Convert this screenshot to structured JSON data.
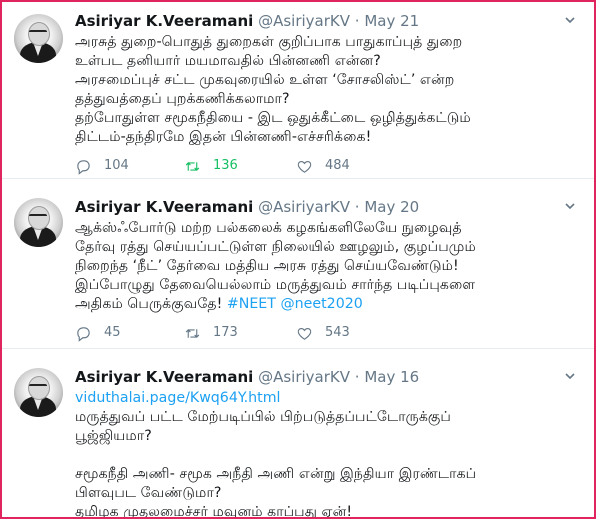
{
  "tweets": [
    {
      "name": "Asiriyar K.Veeramani",
      "handle": "@AsiriyarKV",
      "separator": "·",
      "date": "May 21",
      "lines": [
        "அரசுத் துறை-பொதுத் துறைகள் குறிப்பாக பாதுகாப்புத் துறை",
        "உள்பட தனியார் மயமாவதில் பின்னணி என்ன?",
        "அரசமைப்புச் சட்ட முகவுரையில் உள்ள ‘சோசலிஸ்ட்’ என்ற",
        "தத்துவத்தைப் புறக்கணிக்கலாமா?",
        "தற்போதுள்ள சமூகநீதியை - இட ஒதுக்கீட்டை ஒழித்துக்கட்டும்",
        "திட்டம்-தந்திரமே இதன் பின்னணி-எச்சரிக்கை!"
      ],
      "replies": "104",
      "retweets": "136",
      "likes": "484"
    },
    {
      "name": "Asiriyar K.Veeramani",
      "handle": "@AsiriyarKV",
      "separator": "·",
      "date": "May 20",
      "lines": [
        "ஆக்ஸ்ஃபோர்டு மற்ற பல்கலைக் கழகங்களிலேயே நுழைவுத்",
        "தேர்வு ரத்து செய்யப்பட்டுள்ள நிலையில் ஊழலும், குழப்பமும்",
        "நிறைந்த ‘நீட்’ தேர்வை மத்திய அரசு ரத்து செய்யவேண்டும்!",
        "இப்போழுது தேவையெல்லாம் மருத்துவம் சார்ந்த படிப்புகளை"
      ],
      "last_line_text": "அதிகம் பெருக்குவதே! ",
      "hashtags": [
        "#NEET",
        "@neet2020"
      ],
      "replies": "45",
      "retweets": "173",
      "likes": "543"
    },
    {
      "name": "Asiriyar K.Veeramani",
      "handle": "@AsiriyarKV",
      "separator": "·",
      "date": "May 16",
      "link": "viduthalai.page/Kwq64Y.html",
      "lines": [
        "மருத்துவப் பட்ட மேற்படிப்பில் பிற்படுத்தப்பட்டோருக்குப்",
        "பூஜ்ஜியமா?",
        "",
        "சமூகநீதி அணி- சமூக அநீதி அணி என்று இந்தியா இரண்டாகப்",
        "பிளவுபட வேண்டுமா?",
        "தமிழக முதலமைச்சர் மவுனம் காப்பது ஏன்!"
      ]
    }
  ],
  "icons": {
    "reply": "reply-icon",
    "retweet": "retweet-icon",
    "like": "heart-icon",
    "more": "chevron-down-icon"
  },
  "colors": {
    "frame_border": "#e0245e",
    "retweet_active": "#17bf63",
    "link": "#1da1f2",
    "muted": "#657786"
  }
}
